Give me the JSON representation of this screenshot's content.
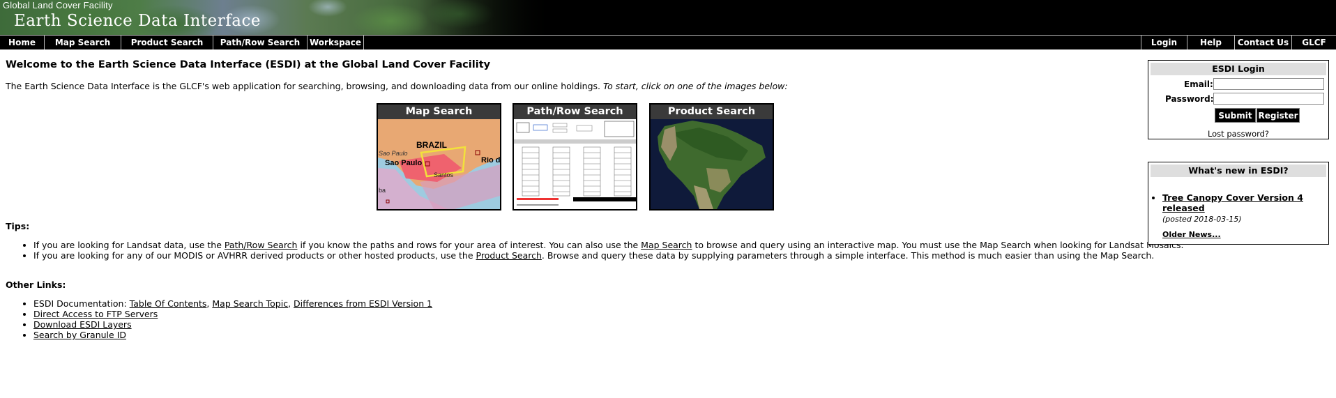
{
  "header": {
    "small_title": "Global Land Cover Facility",
    "big_title": "Earth Science Data Interface"
  },
  "nav": {
    "left": [
      {
        "label": "Home"
      },
      {
        "label": "Map Search"
      },
      {
        "label": "Product Search"
      },
      {
        "label": "Path/Row Search"
      },
      {
        "label": "Workspace"
      }
    ],
    "right": [
      {
        "label": "Login"
      },
      {
        "label": "Help"
      },
      {
        "label": "Contact Us"
      },
      {
        "label": "GLCF"
      }
    ]
  },
  "main": {
    "title": "Welcome to the Earth Science Data Interface (ESDI) at the Global Land Cover Facility",
    "intro": "The Earth Science Data Interface is the GLCF's web application for searching, browsing, and downloading data from our online holdings.",
    "intro_em": "To start, click on one of the images below:",
    "thumbs": [
      {
        "label": "Map Search",
        "map_labels": {
          "country": "BRAZIL",
          "city1": "Sao Paulo",
          "city2": "Sao Paulo",
          "city3": "Santos",
          "city4": "Rio d",
          "city5": "ba"
        }
      },
      {
        "label": "Path/Row Search"
      },
      {
        "label": "Product Search"
      }
    ],
    "tips_heading": "Tips:",
    "tips": [
      {
        "t1": "If you are looking for Landsat data, use the ",
        "l1": "Path/Row Search",
        "t2": " if you know the paths and rows for your area of interest. You can also use the ",
        "l2": "Map Search",
        "t3": " to browse and query using an interactive map. You must use the Map Search when looking for Landsat Mosaics."
      },
      {
        "t1": "If you are looking for any of our MODIS or AVHRR derived products or other hosted products, use the ",
        "l1": "Product Search",
        "t2": ". Browse and query these data by supplying parameters through a simple interface. This method is much easier than using the Map Search."
      }
    ],
    "links_heading": "Other Links:",
    "links": {
      "doc_prefix": "ESDI Documentation: ",
      "doc_links": [
        "Table Of Contents",
        "Map Search Topic",
        "Differences from ESDI Version 1"
      ],
      "sep": ", ",
      "others": [
        "Direct Access to FTP Servers",
        "Download ESDI Layers",
        "Search by Granule ID"
      ]
    }
  },
  "login": {
    "heading": "ESDI Login",
    "email_label": "Email:",
    "password_label": "Password:",
    "submit": "Submit",
    "register": "Register",
    "lost": "Lost password?"
  },
  "news": {
    "heading": "What's new in ESDI?",
    "item_title": "Tree Canopy Cover Version 4 released",
    "item_posted": "(posted 2018-03-15)",
    "older": "Older News..."
  }
}
